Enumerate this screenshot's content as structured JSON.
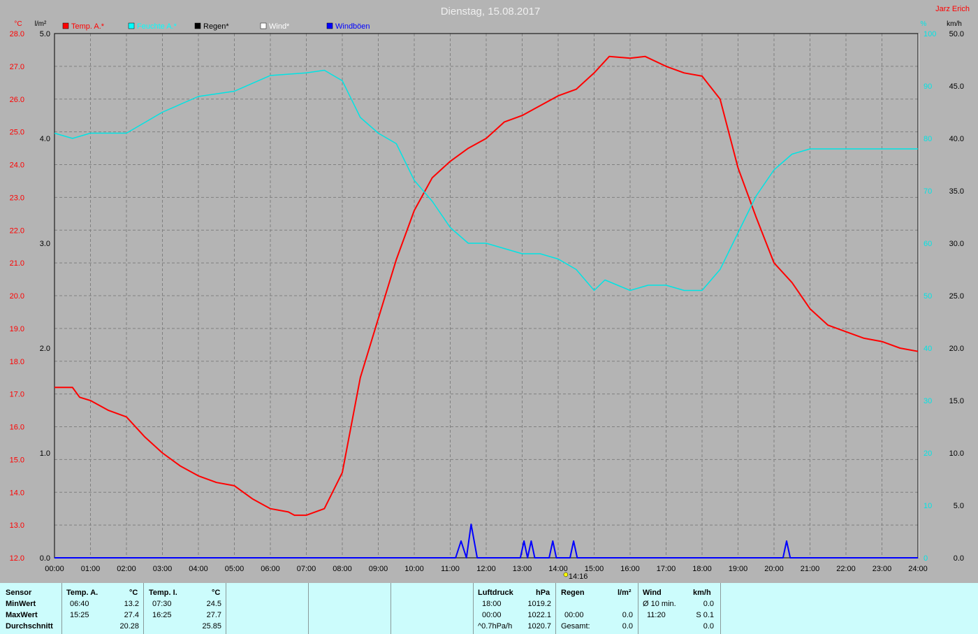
{
  "title": "Dienstag, 15.08.2017",
  "author": "Jarz Erich",
  "units": {
    "left1": "°C",
    "left2": "l/m²",
    "right1": "%",
    "right2": "km/h"
  },
  "legend": [
    {
      "name": "Temp. A.*",
      "color": "#ff0000"
    },
    {
      "name": "Feuchte A.*",
      "color": "#00ffff"
    },
    {
      "name": "Regen*",
      "color": "#000000"
    },
    {
      "name": "Wind*",
      "color": "#ffffff"
    },
    {
      "name": "Windböen",
      "color": "#0000ff"
    }
  ],
  "colors": {
    "background": "#b4b4b4",
    "grid": "#808080",
    "temp": "#ff0000",
    "hum": "#00e4e4",
    "gust": "#0000ff",
    "table_bg": "#ccfcfc"
  },
  "marker": {
    "label": "14:16",
    "hour": 14.27
  },
  "chart_data": {
    "type": "line",
    "x_unit": "hours",
    "xticks": [
      "00:00",
      "01:00",
      "02:00",
      "03:00",
      "04:00",
      "05:00",
      "06:00",
      "07:00",
      "08:00",
      "09:00",
      "10:00",
      "11:00",
      "12:00",
      "13:00",
      "14:00",
      "15:00",
      "16:00",
      "17:00",
      "18:00",
      "19:00",
      "20:00",
      "21:00",
      "22:00",
      "23:00",
      "24:00"
    ],
    "axes": {
      "temp": {
        "ylim": [
          12,
          28
        ],
        "ticks": [
          "12.0",
          "13.0",
          "14.0",
          "15.0",
          "16.0",
          "17.0",
          "18.0",
          "19.0",
          "20.0",
          "21.0",
          "22.0",
          "23.0",
          "24.0",
          "25.0",
          "26.0",
          "27.0",
          "28.0"
        ]
      },
      "rain": {
        "ylim": [
          0,
          5
        ],
        "ticks": [
          "0.0",
          "1.0",
          "2.0",
          "3.0",
          "4.0",
          "5.0"
        ]
      },
      "hum": {
        "ylim": [
          0,
          100
        ],
        "ticks": [
          "0",
          "10",
          "20",
          "30",
          "40",
          "50",
          "60",
          "70",
          "80",
          "90",
          "100"
        ]
      },
      "wind": {
        "ylim": [
          0,
          50
        ],
        "ticks": [
          "0.0",
          "5.0",
          "10.0",
          "15.0",
          "20.0",
          "25.0",
          "30.0",
          "35.0",
          "40.0",
          "45.0",
          "50.0"
        ]
      }
    },
    "grid": true,
    "series": [
      {
        "name": "Temp. A.*",
        "axis": "temp",
        "points": [
          [
            0,
            17.2
          ],
          [
            0.5,
            17.2
          ],
          [
            0.7,
            16.9
          ],
          [
            1,
            16.8
          ],
          [
            1.5,
            16.5
          ],
          [
            2,
            16.3
          ],
          [
            2.5,
            15.7
          ],
          [
            3,
            15.2
          ],
          [
            3.5,
            14.8
          ],
          [
            4,
            14.5
          ],
          [
            4.5,
            14.3
          ],
          [
            5,
            14.2
          ],
          [
            5.5,
            13.8
          ],
          [
            6,
            13.5
          ],
          [
            6.5,
            13.4
          ],
          [
            6.67,
            13.3
          ],
          [
            7,
            13.3
          ],
          [
            7.5,
            13.5
          ],
          [
            8,
            14.6
          ],
          [
            8.5,
            17.5
          ],
          [
            9,
            19.3
          ],
          [
            9.5,
            21.1
          ],
          [
            10,
            22.6
          ],
          [
            10.5,
            23.6
          ],
          [
            11,
            24.1
          ],
          [
            11.5,
            24.5
          ],
          [
            12,
            24.8
          ],
          [
            12.5,
            25.3
          ],
          [
            13,
            25.5
          ],
          [
            13.5,
            25.8
          ],
          [
            14,
            26.1
          ],
          [
            14.5,
            26.3
          ],
          [
            15,
            26.8
          ],
          [
            15.42,
            27.3
          ],
          [
            16,
            27.25
          ],
          [
            16.42,
            27.3
          ],
          [
            17,
            27.0
          ],
          [
            17.5,
            26.8
          ],
          [
            18,
            26.7
          ],
          [
            18.5,
            26.0
          ],
          [
            19,
            23.9
          ],
          [
            19.5,
            22.4
          ],
          [
            20,
            21.0
          ],
          [
            20.5,
            20.4
          ],
          [
            21,
            19.6
          ],
          [
            21.5,
            19.1
          ],
          [
            22,
            18.9
          ],
          [
            22.5,
            18.7
          ],
          [
            23,
            18.6
          ],
          [
            23.5,
            18.4
          ],
          [
            24,
            18.3
          ]
        ]
      },
      {
        "name": "Feuchte A.*",
        "axis": "hum",
        "points": [
          [
            0,
            81
          ],
          [
            0.5,
            80
          ],
          [
            1,
            81
          ],
          [
            2,
            81
          ],
          [
            2.5,
            83
          ],
          [
            3,
            85
          ],
          [
            4,
            88
          ],
          [
            5,
            89
          ],
          [
            6,
            92
          ],
          [
            7,
            92.5
          ],
          [
            7.5,
            93
          ],
          [
            8,
            91
          ],
          [
            8.5,
            84
          ],
          [
            9,
            81
          ],
          [
            9.5,
            79
          ],
          [
            10,
            72
          ],
          [
            10.5,
            68
          ],
          [
            11,
            63
          ],
          [
            11.5,
            60
          ],
          [
            12,
            60
          ],
          [
            12.5,
            59
          ],
          [
            13,
            58
          ],
          [
            13.5,
            58
          ],
          [
            14,
            57
          ],
          [
            14.5,
            55
          ],
          [
            15,
            51
          ],
          [
            15.3,
            53
          ],
          [
            16,
            51
          ],
          [
            16.5,
            52
          ],
          [
            17,
            52
          ],
          [
            17.5,
            51
          ],
          [
            18,
            51
          ],
          [
            18.5,
            55
          ],
          [
            19,
            62
          ],
          [
            19.5,
            69
          ],
          [
            20,
            74
          ],
          [
            20.5,
            77
          ],
          [
            21,
            78
          ],
          [
            22,
            78
          ],
          [
            23,
            78
          ],
          [
            24,
            78
          ]
        ]
      },
      {
        "name": "Windböen",
        "axis": "wind",
        "points": [
          [
            0,
            0
          ],
          [
            11.15,
            0
          ],
          [
            11.3,
            1.6
          ],
          [
            11.45,
            0
          ],
          [
            11.58,
            3.2
          ],
          [
            11.75,
            0
          ],
          [
            12.95,
            0
          ],
          [
            13.05,
            1.6
          ],
          [
            13.15,
            0
          ],
          [
            13.25,
            1.6
          ],
          [
            13.35,
            0
          ],
          [
            13.75,
            0
          ],
          [
            13.85,
            1.6
          ],
          [
            13.95,
            0
          ],
          [
            14.33,
            0
          ],
          [
            14.43,
            1.6
          ],
          [
            14.53,
            0
          ],
          [
            20.25,
            0
          ],
          [
            20.35,
            1.6
          ],
          [
            20.45,
            0
          ],
          [
            24,
            0
          ]
        ]
      }
    ]
  },
  "table": {
    "sensor_header": "Sensor",
    "rows": [
      "MinWert",
      "MaxWert",
      "Durchschnitt"
    ],
    "tempA": {
      "label": "Temp. A.",
      "unit": "°C",
      "times": [
        "06:40",
        "15:25",
        ""
      ],
      "values": [
        "13.2",
        "27.4",
        "20.28"
      ]
    },
    "tempI": {
      "label": "Temp. I.",
      "unit": "°C",
      "times": [
        "07:30",
        "16:25",
        ""
      ],
      "values": [
        "24.5",
        "27.7",
        "25.85"
      ]
    },
    "pressure": {
      "label": "Luftdruck",
      "unit": "hPa",
      "times": [
        "18:00",
        "00:00",
        "^0.7hPa/h"
      ],
      "values": [
        "1019.2",
        "1022.1",
        "1020.7"
      ]
    },
    "rain": {
      "label": "Regen",
      "unit": "l/m²",
      "times": [
        "",
        "00:00",
        "Gesamt:"
      ],
      "values": [
        "",
        "0.0",
        "0.0"
      ]
    },
    "wind": {
      "label": "Wind",
      "unit": "km/h",
      "times": [
        "Ø 10 min.",
        "11:20",
        ""
      ],
      "values": [
        "0.0",
        "S 0.1",
        "0.0"
      ]
    }
  }
}
